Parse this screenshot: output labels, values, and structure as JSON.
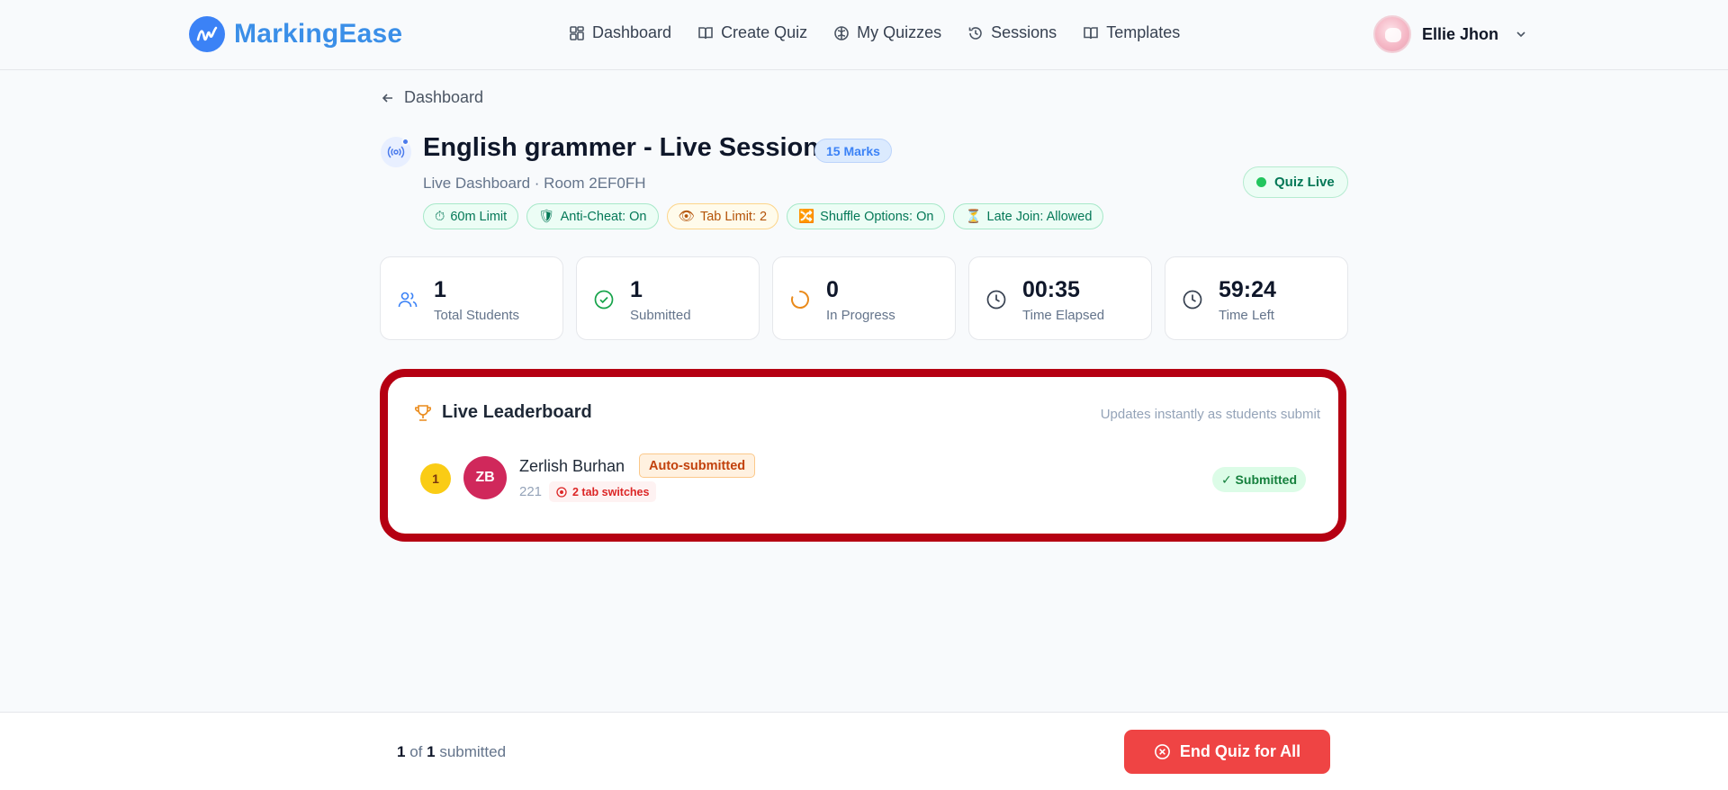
{
  "brand": {
    "name": "MarkingEase"
  },
  "nav": [
    {
      "label": "Dashboard",
      "icon": "grid-icon"
    },
    {
      "label": "Create Quiz",
      "icon": "book-open-icon"
    },
    {
      "label": "My Quizzes",
      "icon": "brain-icon"
    },
    {
      "label": "Sessions",
      "icon": "history-icon"
    },
    {
      "label": "Templates",
      "icon": "book-icon"
    }
  ],
  "user": {
    "name": "Ellie Jhon"
  },
  "breadcrumb": {
    "back_label": "Dashboard"
  },
  "session": {
    "title": "English grammer - Live Session",
    "marks": "15 Marks",
    "subtitle": "Live Dashboard · Room 2EF0FH",
    "status": "Quiz Live",
    "chips": [
      {
        "icon": "⏱",
        "label": "60m Limit",
        "tone": "green"
      },
      {
        "icon": "🛡",
        "label": "Anti-Cheat: On",
        "tone": "green"
      },
      {
        "icon": "👁",
        "label": "Tab Limit: 2",
        "tone": "yellow"
      },
      {
        "icon": "🔀",
        "label": "Shuffle Options: On",
        "tone": "green"
      },
      {
        "icon": "⏳",
        "label": "Late Join: Allowed",
        "tone": "green"
      }
    ]
  },
  "stats": [
    {
      "value": "1",
      "label": "Total Students",
      "icon": "users-icon",
      "color": "#3b82f6"
    },
    {
      "value": "1",
      "label": "Submitted",
      "icon": "check-circle-icon",
      "color": "#16a34a"
    },
    {
      "value": "0",
      "label": "In Progress",
      "icon": "loader-icon",
      "color": "#ea8a1a"
    },
    {
      "value": "00:35",
      "label": "Time Elapsed",
      "icon": "clock-icon",
      "color": "#374151"
    },
    {
      "value": "59:24",
      "label": "Time Left",
      "icon": "clock-icon",
      "color": "#374151"
    }
  ],
  "leaderboard": {
    "title": "Live Leaderboard",
    "note": "Updates instantly as students submit",
    "entries": [
      {
        "rank": "1",
        "initials": "ZB",
        "name": "Zerlish Burhan",
        "badge": "Auto-submitted",
        "id": "221",
        "warning": "2 tab switches",
        "status": "✓ Submitted"
      }
    ]
  },
  "footer": {
    "submitted": "1",
    "of_word": "of",
    "total": "1",
    "suffix": "submitted",
    "end_button": "End Quiz for All"
  },
  "colors": {
    "accent": "#3b82f6",
    "danger": "#ef4444",
    "highlight_border": "#b50012"
  }
}
